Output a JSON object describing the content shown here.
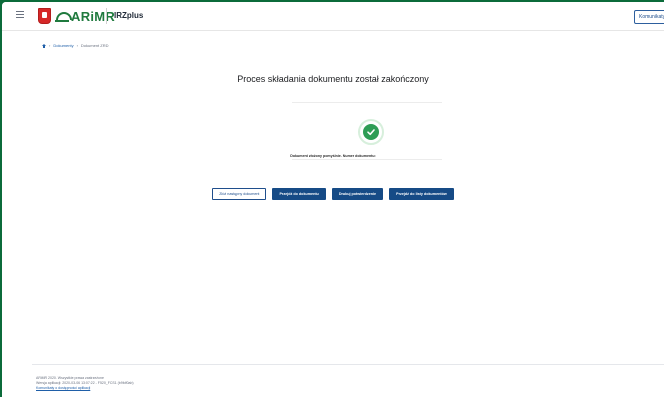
{
  "header": {
    "brand": "ARiMR",
    "app_name": "IRZplus",
    "notifications_label": "Komunikaty"
  },
  "breadcrumb": [
    {
      "label": "Dokumenty"
    },
    {
      "label": "Dokument ZRD"
    }
  ],
  "main": {
    "title": "Proces składania dokumentu został zakończony",
    "status_text": "Dokument złożony pomyślnie. Numer dokumentu:",
    "buttons": {
      "next_document": "Złóż następny dokument",
      "go_to_document": "Przejdź do dokumentu",
      "print_confirmation": "Drukuj potwierdzenie",
      "go_to_list": "Przejdź do listy dokumentów"
    }
  },
  "footer": {
    "copyright": "ARiMR 2020. Wszystkie prawa zastrzeżone",
    "version": "Wersja aplikacji: 2020-03-06 13:07:22 - F520_FCS1 (b9fdf0ab)",
    "accessibility_link": "Komunikaty o dostępności aplikacji"
  },
  "colors": {
    "primary": "#164b86",
    "brand_green": "#1f7a3e",
    "success": "#2e9d55"
  }
}
